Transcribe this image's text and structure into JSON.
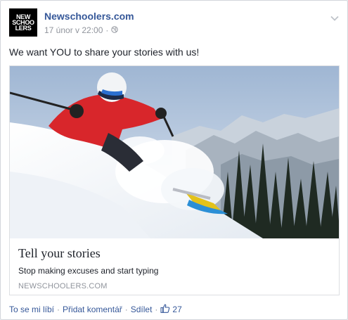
{
  "post": {
    "page_name": "Newschoolers.com",
    "avatar_lines": [
      "NEW",
      "SCHOO",
      "LERS"
    ],
    "timestamp": "17 únor v 22:00",
    "meta_separator": "·",
    "text": "We want YOU to share your stories with us!"
  },
  "card": {
    "title": "Tell your stories",
    "description": "Stop making excuses and start typing",
    "domain": "NEWSCHOOLERS.COM"
  },
  "actions": {
    "like": "To se mi líbí",
    "comment": "Přidat komentář",
    "share": "Sdílet",
    "separator": "·",
    "like_count": "27"
  },
  "icons": {
    "audience": "globe-icon",
    "options": "chevron-down-icon",
    "likes": "thumbs-up-icon"
  },
  "colors": {
    "link": "#365899",
    "meta": "#90949c",
    "text": "#1d2129"
  }
}
